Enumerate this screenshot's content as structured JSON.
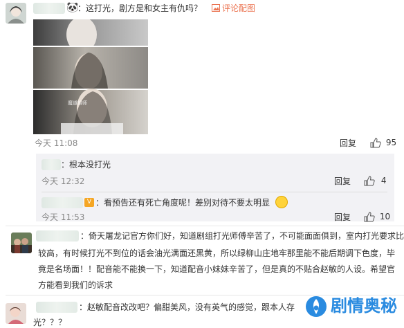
{
  "comment1": {
    "text": "：这打光，剧方是和女主有仇吗？",
    "view_image_label": "评论配图",
    "time": "今天 11:08",
    "reply_label": "回复",
    "like_count": "95",
    "image_caption": "魔道祖师"
  },
  "sub_replies": [
    {
      "text": "：根本没打光",
      "time": "今天 12:32",
      "reply_label": "回复",
      "like_count": "4"
    },
    {
      "text": "：看预告还有死亡角度呢！差别对待不要太明显",
      "time": "今天 11:53",
      "reply_label": "回复",
      "like_count": "10"
    }
  ],
  "comment2": {
    "lines": [
      "：倚天屠龙记官方你们好，知道剧组打光师傅辛苦了，不可能面面俱到，室内打光要求比",
      "较高，有时候打光不到位的话会油光满面还黑黄，所以绿柳山庄地牢那里能不能后期调下色度，毕",
      "竟是名场面！！配音能不能换一下，知道配音小妹妹辛苦了，但是真的不贴合赵敏的人设。希望官",
      "方能看到我们的诉求"
    ]
  },
  "comment3": {
    "lines": [
      "：赵敏配音改改吧？偏甜美风，没有英气的感觉，跟本人存",
      "光？？？"
    ]
  },
  "watermark": {
    "text": "剧情奥秘"
  },
  "colors": {
    "accent": "#eb7350",
    "reply_bg": "#f2f2f5",
    "muted": "#888888"
  }
}
